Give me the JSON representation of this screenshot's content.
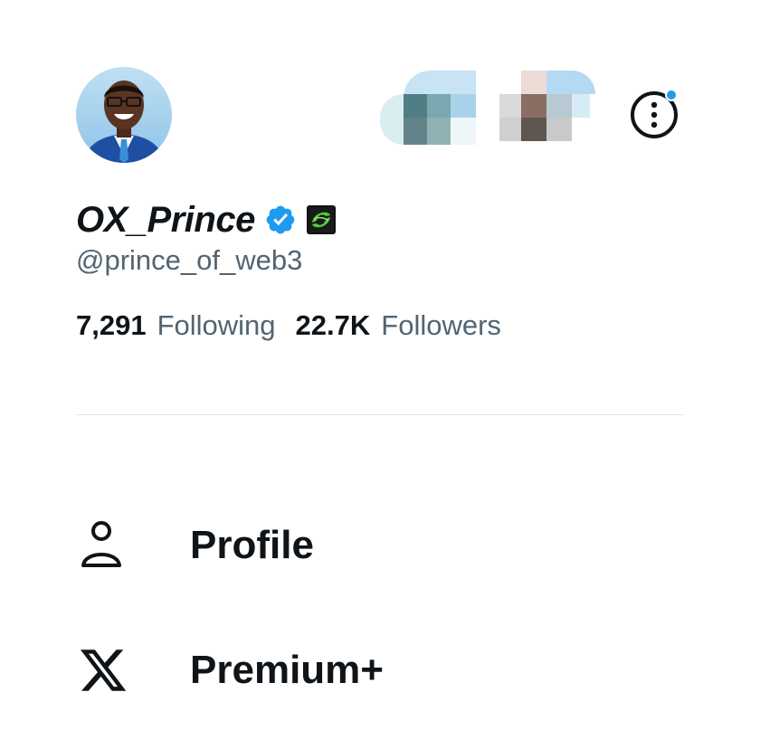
{
  "profile": {
    "display_name": "OX_Prince",
    "handle": "@prince_of_web3",
    "following_count": "7,291",
    "following_label": "Following",
    "followers_count": "22.7K",
    "followers_label": "Followers"
  },
  "icons": {
    "verified": "verified-badge-icon",
    "affiliate": "affiliate-badge-icon",
    "more": "more-options-icon",
    "profile": "person-icon",
    "premium": "x-logo-icon"
  },
  "menu": {
    "items": [
      {
        "label": "Profile",
        "icon": "person-icon"
      },
      {
        "label": "Premium+",
        "icon": "x-logo-icon"
      }
    ]
  },
  "colors": {
    "text_primary": "#0f1419",
    "text_secondary": "#536471",
    "accent": "#1d9bf0",
    "divider": "#dfe4e8"
  }
}
